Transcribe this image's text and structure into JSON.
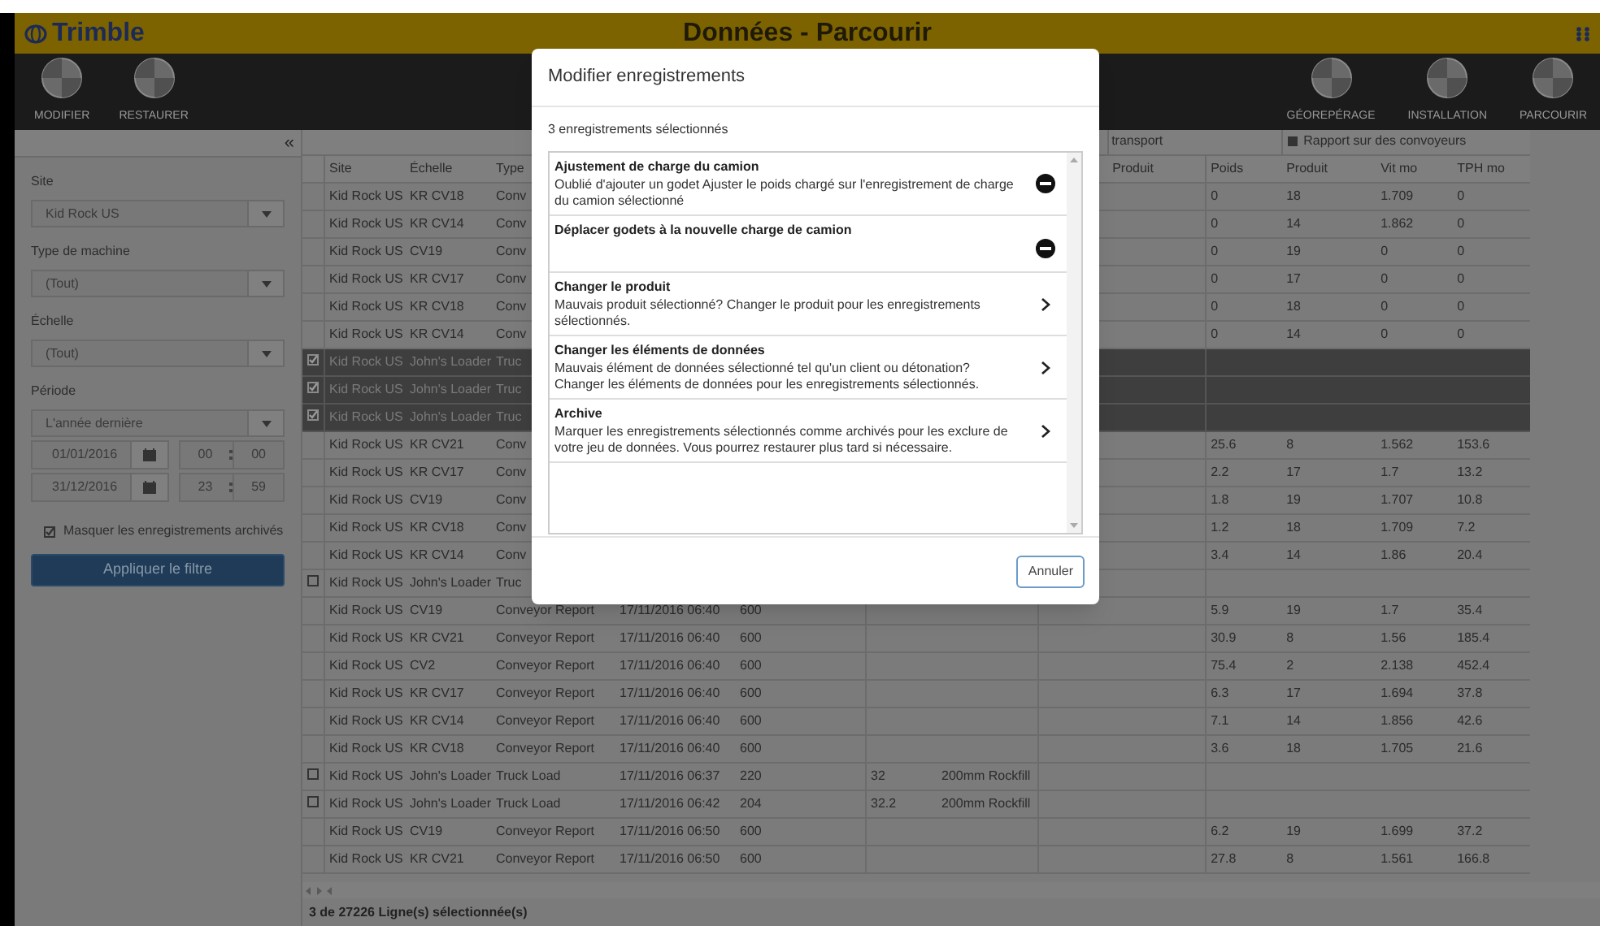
{
  "header": {
    "logo": "Trimble",
    "title": "Données - Parcourir"
  },
  "toolbar": {
    "left": [
      {
        "label": "MODIFIER"
      },
      {
        "label": "RESTAURER"
      }
    ],
    "right": [
      {
        "label": "GÉOREPÉRAGE"
      },
      {
        "label": "INSTALLATION"
      },
      {
        "label": "PARCOURIR"
      }
    ]
  },
  "sidebar": {
    "collapse": "«",
    "filters": [
      {
        "label": "Site",
        "value": "Kid Rock US"
      },
      {
        "label": "Type de machine",
        "value": "(Tout)"
      },
      {
        "label": "Échelle",
        "value": "(Tout)"
      },
      {
        "label": "Période",
        "value": "L'année dernière"
      }
    ],
    "dates": [
      {
        "date": "01/01/2016",
        "hour": "00",
        "minute": "00"
      },
      {
        "date": "31/12/2016",
        "hour": "23",
        "minute": "59"
      }
    ],
    "hide_archived": {
      "label": "Masquer les enregistrements archivés",
      "checked": true
    },
    "apply": "Appliquer le filtre"
  },
  "table": {
    "group_headers": [
      {
        "label": "transport"
      },
      {
        "label": "Rapport sur des convoyeurs"
      }
    ],
    "columns": [
      {
        "label": "Site"
      },
      {
        "label": "Échelle"
      },
      {
        "label": "Type"
      },
      {},
      {},
      {},
      {},
      {},
      {
        "label": "Produit"
      },
      {
        "label": "Poids"
      },
      {
        "label": "Produit"
      },
      {
        "label": "Vit mo"
      },
      {
        "label": "TPH mo"
      }
    ],
    "rows": [
      {
        "selected": false,
        "cells": [
          "Kid Rock US",
          "KR CV18",
          "Conv",
          null,
          null,
          null,
          null,
          null,
          null,
          "0",
          "18",
          "1.709",
          "0"
        ]
      },
      {
        "selected": false,
        "cells": [
          "Kid Rock US",
          "KR CV14",
          "Conv",
          null,
          null,
          null,
          null,
          null,
          null,
          "0",
          "14",
          "1.862",
          "0"
        ]
      },
      {
        "selected": false,
        "cells": [
          "Kid Rock US",
          "CV19",
          "Conv",
          null,
          null,
          null,
          null,
          null,
          null,
          "0",
          "19",
          "0",
          "0"
        ]
      },
      {
        "selected": false,
        "cells": [
          "Kid Rock US",
          "KR CV17",
          "Conv",
          null,
          null,
          null,
          null,
          null,
          null,
          "0",
          "17",
          "0",
          "0"
        ]
      },
      {
        "selected": false,
        "cells": [
          "Kid Rock US",
          "KR CV18",
          "Conv",
          null,
          null,
          null,
          null,
          null,
          null,
          "0",
          "18",
          "0",
          "0"
        ]
      },
      {
        "selected": false,
        "cells": [
          "Kid Rock US",
          "KR CV14",
          "Conv",
          null,
          null,
          null,
          null,
          null,
          null,
          "0",
          "14",
          "0",
          "0"
        ]
      },
      {
        "selected": true,
        "checked": true,
        "cells": [
          "Kid Rock US",
          "John's Loader",
          "Truc",
          null,
          null,
          null,
          null,
          null,
          null,
          null,
          null,
          null,
          null
        ]
      },
      {
        "selected": true,
        "checked": true,
        "cells": [
          "Kid Rock US",
          "John's Loader",
          "Truc",
          null,
          null,
          null,
          null,
          null,
          null,
          null,
          null,
          null,
          null
        ]
      },
      {
        "selected": true,
        "checked": true,
        "cells": [
          "Kid Rock US",
          "John's Loader",
          "Truc",
          null,
          null,
          null,
          null,
          null,
          null,
          null,
          null,
          null,
          null
        ]
      },
      {
        "selected": false,
        "cells": [
          "Kid Rock US",
          "KR CV21",
          "Conv",
          null,
          null,
          null,
          null,
          null,
          null,
          "25.6",
          "8",
          "1.562",
          "153.6"
        ]
      },
      {
        "selected": false,
        "cells": [
          "Kid Rock US",
          "KR CV17",
          "Conv",
          null,
          null,
          null,
          null,
          null,
          null,
          "2.2",
          "17",
          "1.7",
          "13.2"
        ]
      },
      {
        "selected": false,
        "cells": [
          "Kid Rock US",
          "CV19",
          "Conv",
          null,
          null,
          null,
          null,
          null,
          null,
          "1.8",
          "19",
          "1.707",
          "10.8"
        ]
      },
      {
        "selected": false,
        "cells": [
          "Kid Rock US",
          "KR CV18",
          "Conv",
          null,
          null,
          null,
          null,
          null,
          null,
          "1.2",
          "18",
          "1.709",
          "7.2"
        ]
      },
      {
        "selected": false,
        "cells": [
          "Kid Rock US",
          "KR CV14",
          "Conv",
          null,
          null,
          null,
          null,
          null,
          null,
          "3.4",
          "14",
          "1.86",
          "20.4"
        ]
      },
      {
        "selected": false,
        "checked": false,
        "cells": [
          "Kid Rock US",
          "John's Loader",
          "Truc",
          null,
          null,
          null,
          null,
          null,
          null,
          null,
          null,
          null,
          null
        ]
      },
      {
        "selected": false,
        "cells": [
          "Kid Rock US",
          "CV19",
          "Conveyor Report",
          "17/11/2016 06:40",
          "600",
          null,
          null,
          null,
          null,
          "5.9",
          "19",
          "1.7",
          "35.4"
        ]
      },
      {
        "selected": false,
        "cells": [
          "Kid Rock US",
          "KR CV21",
          "Conveyor Report",
          "17/11/2016 06:40",
          "600",
          null,
          null,
          null,
          null,
          "30.9",
          "8",
          "1.56",
          "185.4"
        ]
      },
      {
        "selected": false,
        "cells": [
          "Kid Rock US",
          "CV2",
          "Conveyor Report",
          "17/11/2016 06:40",
          "600",
          null,
          null,
          null,
          null,
          "75.4",
          "2",
          "2.138",
          "452.4"
        ]
      },
      {
        "selected": false,
        "cells": [
          "Kid Rock US",
          "KR CV17",
          "Conveyor Report",
          "17/11/2016 06:40",
          "600",
          null,
          null,
          null,
          null,
          "6.3",
          "17",
          "1.694",
          "37.8"
        ]
      },
      {
        "selected": false,
        "cells": [
          "Kid Rock US",
          "KR CV14",
          "Conveyor Report",
          "17/11/2016 06:40",
          "600",
          null,
          null,
          null,
          null,
          "7.1",
          "14",
          "1.856",
          "42.6"
        ]
      },
      {
        "selected": false,
        "cells": [
          "Kid Rock US",
          "KR CV18",
          "Conveyor Report",
          "17/11/2016 06:40",
          "600",
          null,
          null,
          null,
          null,
          "3.6",
          "18",
          "1.705",
          "21.6"
        ]
      },
      {
        "selected": false,
        "checked": false,
        "cells": [
          "Kid Rock US",
          "John's Loader",
          "Truck Load",
          "17/11/2016 06:37",
          "220",
          "32",
          "200mm Rockfill",
          null,
          null,
          null,
          null,
          null,
          null
        ]
      },
      {
        "selected": false,
        "checked": false,
        "cells": [
          "Kid Rock US",
          "John's Loader",
          "Truck Load",
          "17/11/2016 06:42",
          "204",
          "32.2",
          "200mm Rockfill",
          null,
          null,
          null,
          null,
          null,
          null
        ]
      },
      {
        "selected": false,
        "cells": [
          "Kid Rock US",
          "CV19",
          "Conveyor Report",
          "17/11/2016 06:50",
          "600",
          null,
          null,
          null,
          null,
          "6.2",
          "19",
          "1.699",
          "37.2"
        ]
      },
      {
        "selected": false,
        "cells": [
          "Kid Rock US",
          "KR CV21",
          "Conveyor Report",
          "17/11/2016 06:50",
          "600",
          null,
          null,
          null,
          null,
          "27.8",
          "8",
          "1.561",
          "166.8"
        ]
      }
    ]
  },
  "status_bar": "3 de 27226 Ligne(s) sélectionnée(s)",
  "dialog": {
    "title": "Modifier enregistrements",
    "subtitle": "3 enregistrements sélectionnés",
    "items": [
      {
        "kind": "blocked",
        "title": "Ajustement de charge du camion",
        "description": "Oublié d'ajouter un godet Ajuster le poids chargé sur l'enregistrement de charge du camion sélectionné"
      },
      {
        "kind": "blocked",
        "title": "Déplacer godets à la nouvelle charge de camion"
      },
      {
        "kind": "link",
        "title": "Changer le produit",
        "description": "Mauvais produit sélectionné? Changer le produit pour les enregistrements sélectionnés."
      },
      {
        "kind": "link",
        "title": "Changer les éléments de données",
        "description": "Mauvais élément de données sélectionné tel qu'un client ou détonation? Changer les éléments de données pour les enregistrements sélectionnés."
      },
      {
        "kind": "link",
        "title": "Archive",
        "description": "Marquer les enregistrements sélectionnés comme archivés pour les exclure de votre jeu de données. Vous pourrez restaurer plus tard si nécessaire."
      }
    ],
    "cancel": "Annuler"
  }
}
